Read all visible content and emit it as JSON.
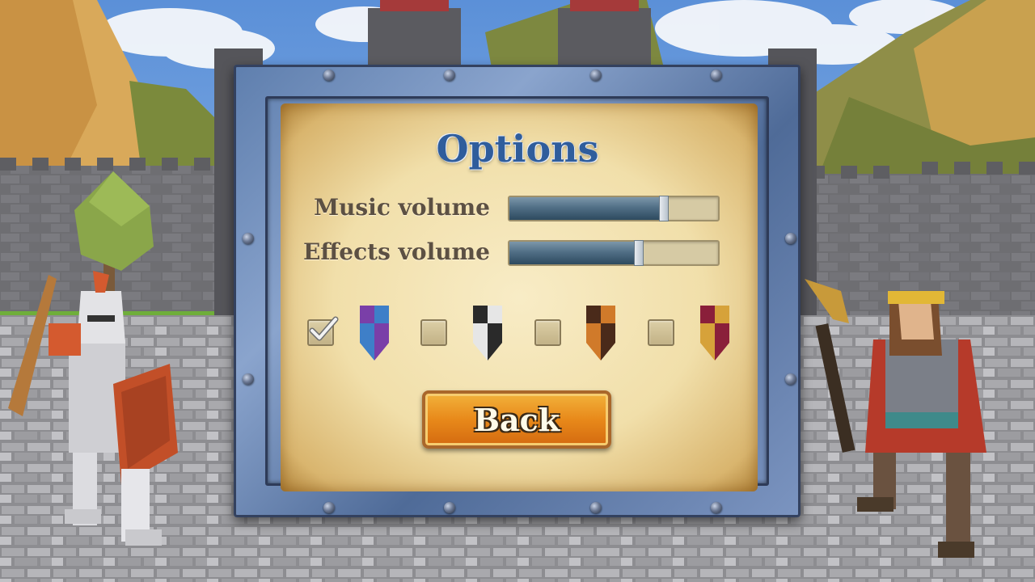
{
  "options": {
    "title": "Options",
    "music_label": "Music volume",
    "music_volume": 0.74,
    "effects_label": "Effects volume",
    "effects_volume": 0.62,
    "back_label": "Back"
  },
  "banner_choices": [
    {
      "name": "blue-purple-shield-icon",
      "selected": true,
      "colors": [
        "#3e7fc8",
        "#7a3fa8"
      ]
    },
    {
      "name": "black-white-shield-icon",
      "selected": false,
      "colors": [
        "#2a2a2a",
        "#e6e6e6"
      ]
    },
    {
      "name": "orange-brown-shield-icon",
      "selected": false,
      "colors": [
        "#d07a2a",
        "#4a2a1a"
      ]
    },
    {
      "name": "crimson-gold-shield-icon",
      "selected": false,
      "colors": [
        "#8a1f3a",
        "#d6a23a"
      ]
    }
  ],
  "colors": {
    "title": "#2f5d9c",
    "button": "#e8891a",
    "frame": "#5f7fae"
  }
}
